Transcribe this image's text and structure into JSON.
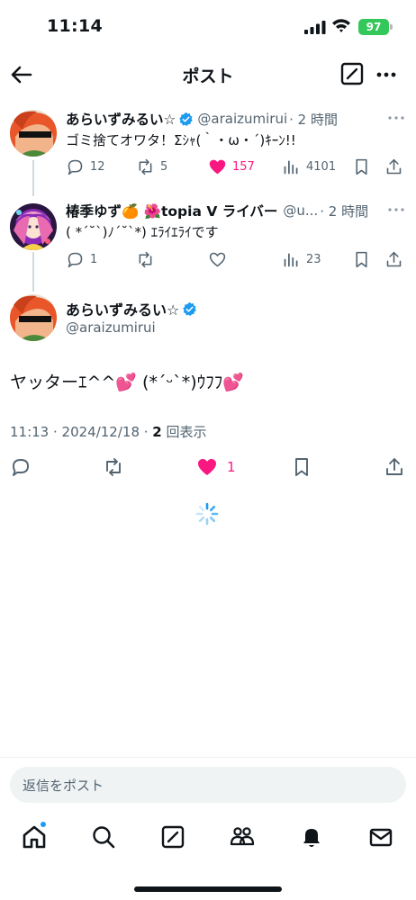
{
  "status_bar": {
    "time": "11:14",
    "battery": "97"
  },
  "header": {
    "title": "ポスト"
  },
  "tweets": [
    {
      "name": "あらいずみるい☆",
      "handle": "@araizumirui",
      "time": "· 2 時間",
      "text": "ゴミ捨てオワタ！Σｼｬ(｀・ω・´)ｷｰﾝ!!",
      "replies": "12",
      "reposts": "5",
      "likes": "157",
      "views": "4101",
      "verified": true,
      "liked": true
    },
    {
      "name": "椿季ゆず🍊 🌺topia V ライバー",
      "handle": "@u...",
      "time": "· 2 時間",
      "text": "( *´˘`)ﾉ´˘`*) ｴﾗｲｴﾗｲです",
      "replies": "1",
      "reposts": "",
      "likes": "",
      "views": "23",
      "verified": false,
      "liked": false
    }
  ],
  "main_tweet": {
    "name": "あらいずみるい☆",
    "handle": "@araizumirui",
    "text": "ヤッターｴ^^💕 (*´ᵕ`*)ｳﾌﾌ💕",
    "timestamp": "11:13 · 2024/12/18 · ",
    "views_count": "2",
    "views_label": " 回表示",
    "likes": "1"
  },
  "reply_bar": {
    "placeholder": "返信をポスト"
  },
  "tab_bar": {
    "items": [
      {
        "icon": "home-icon"
      },
      {
        "icon": "search-icon"
      },
      {
        "icon": "grok-icon"
      },
      {
        "icon": "communities-icon"
      },
      {
        "icon": "notifications-icon"
      },
      {
        "icon": "messages-icon"
      }
    ]
  },
  "colors": {
    "like": "#f91880",
    "verified": "#1d9bf0",
    "secondary": "#536471",
    "battery": "#34c759"
  }
}
